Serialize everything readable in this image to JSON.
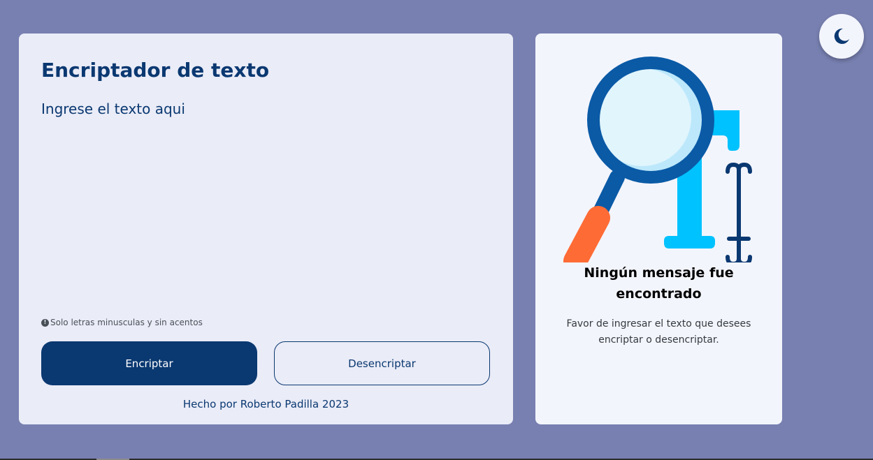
{
  "encoder": {
    "title": "Encriptador de texto",
    "input_placeholder": "Ingrese el texto aqui",
    "hint_icon": "info-icon",
    "hint_text": "Solo letras minusculas y sin acentos",
    "encrypt_label": "Encriptar",
    "decrypt_label": "Desencriptar",
    "footer": "Hecho por Roberto Padilla 2023"
  },
  "result": {
    "illustration_icon": "magnifier-text-icon",
    "title": "Ningún mensaje fue encontrado",
    "description": "Favor de ingresar el texto que desees encriptar o desencriptar."
  },
  "theme_toggle": {
    "icon": "moon-icon"
  },
  "colors": {
    "background": "#7880b1",
    "card": "#eaecf7",
    "result_card": "#f3f5fc",
    "primary": "#0a3871",
    "accent_light_blue": "#00c2ff",
    "accent_orange": "#ff6b35"
  }
}
